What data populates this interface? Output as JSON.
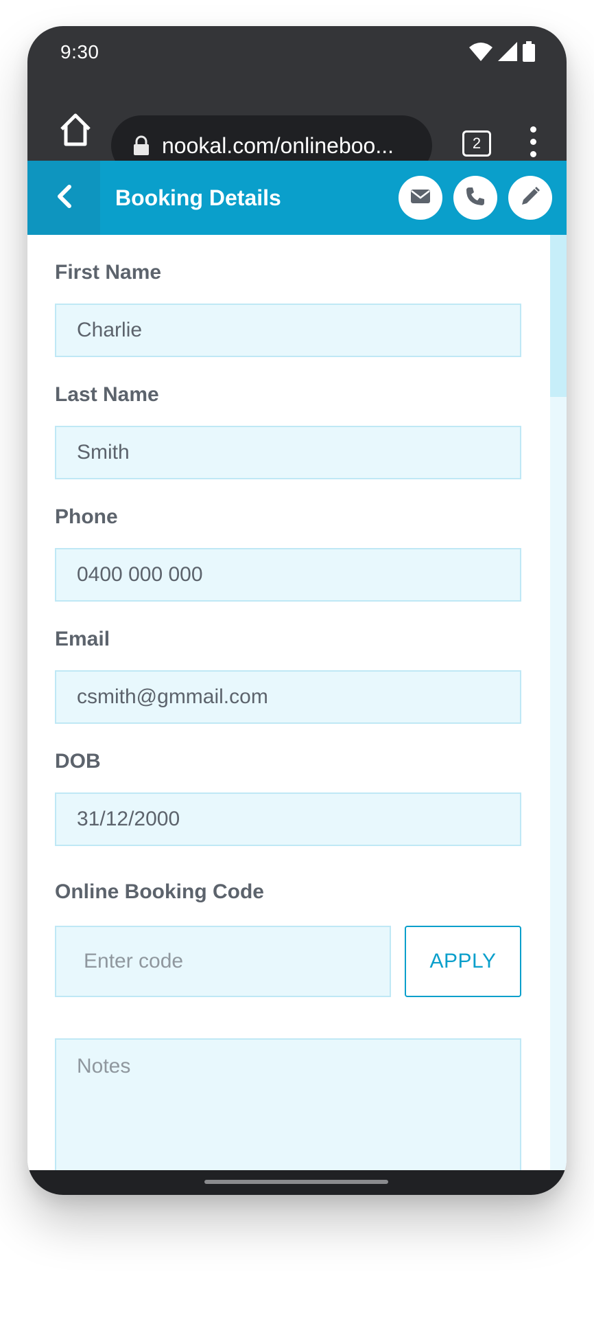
{
  "status_bar": {
    "time": "9:30",
    "icons": [
      "wifi-icon",
      "cellular-signal-icon",
      "battery-icon"
    ]
  },
  "browser": {
    "url": "nookal.com/onlineboo...",
    "tab_count": "2",
    "icons": [
      "home-icon",
      "lock-icon",
      "more-vert-icon"
    ]
  },
  "app_bar": {
    "title": "Booking Details",
    "icons": [
      "chevron-left-icon",
      "envelope-icon",
      "phone-icon",
      "pencil-icon"
    ],
    "accent_color": "#0a9fcb"
  },
  "form": {
    "first_name": {
      "label": "First Name",
      "value": "Charlie"
    },
    "last_name": {
      "label": "Last Name",
      "value": "Smith"
    },
    "phone": {
      "label": "Phone",
      "value": "0400 000 000"
    },
    "email": {
      "label": "Email",
      "value": "csmith@gmmail.com"
    },
    "dob": {
      "label": "DOB",
      "value": "31/12/2000"
    },
    "booking_code": {
      "label": "Online Booking Code",
      "placeholder": "Enter code",
      "apply_label": "APPLY"
    },
    "notes": {
      "placeholder": "Notes"
    }
  }
}
